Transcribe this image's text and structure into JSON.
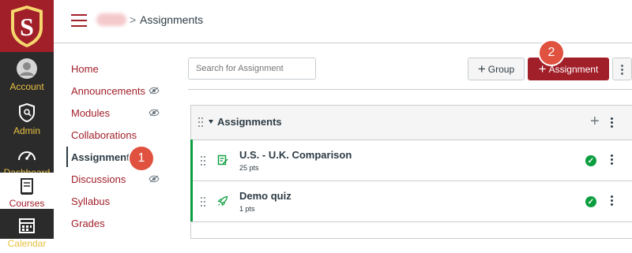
{
  "global_nav": {
    "items": [
      {
        "label": "Account",
        "icon": "account-icon"
      },
      {
        "label": "Admin",
        "icon": "admin-icon"
      },
      {
        "label": "Dashboard",
        "icon": "dashboard-icon"
      },
      {
        "label": "Courses",
        "icon": "courses-icon"
      },
      {
        "label": "Calendar",
        "icon": "calendar-icon"
      }
    ],
    "logo_letter": "S"
  },
  "header": {
    "breadcrumb_separator": ">",
    "breadcrumb_current": "Assignments"
  },
  "course_nav": {
    "items": [
      {
        "label": "Home"
      },
      {
        "label": "Announcements"
      },
      {
        "label": "Modules"
      },
      {
        "label": "Collaborations"
      },
      {
        "label": "Assignments"
      },
      {
        "label": "Discussions"
      },
      {
        "label": "Syllabus"
      },
      {
        "label": "Grades"
      }
    ]
  },
  "toolbar": {
    "search_placeholder": "Search for Assignment",
    "group_button": "Group",
    "assignment_button": "Assignment",
    "plus": "+",
    "more": "⋮"
  },
  "badges": {
    "one": "1",
    "two": "2"
  },
  "assignment_group": {
    "title": "Assignments",
    "rows": [
      {
        "title": "U.S. - U.K. Comparison",
        "points": "25 pts"
      },
      {
        "title": "Demo quiz",
        "points": "1 pts"
      }
    ]
  },
  "colors": {
    "brand": "#a11f29",
    "accent_green": "#0b9e3f",
    "badge": "#e0513f"
  }
}
